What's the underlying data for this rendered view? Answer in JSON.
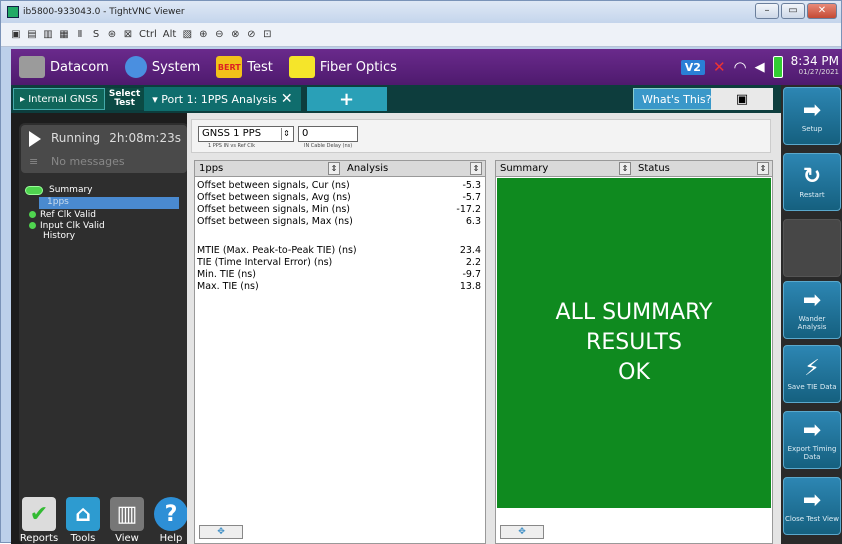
{
  "window": {
    "title": "ib5800-933043.0 - TightVNC Viewer",
    "btn_min": "–",
    "btn_max": "▭",
    "btn_close": "✕"
  },
  "vnc_toolbar": {
    "items": [
      "▣",
      "▤",
      "▥",
      "▦",
      "Ⅱ",
      "S",
      "⊛",
      "⊠",
      "Ctrl",
      "Alt",
      "▧",
      "⊕",
      "⊖",
      "⊗",
      "⊘",
      "⊡"
    ]
  },
  "topbar": {
    "items": [
      {
        "label": "Datacom",
        "icon": "datacom-icon"
      },
      {
        "label": "System",
        "icon": "gear-icon"
      },
      {
        "label": "Test",
        "icon": "test-icon",
        "icon_text": "BERT"
      },
      {
        "label": "Fiber Optics",
        "icon": "fiber-icon"
      }
    ],
    "v2": "V2",
    "time": "8:34 PM",
    "date": "01/27/2021"
  },
  "tabs": {
    "gnss": "▸ Internal GNSS",
    "select_1": "Select",
    "select_2": "Test",
    "port": "▾ Port 1: 1PPS Analysis",
    "add": "+",
    "whats_this": "What's This?",
    "camera": "▣"
  },
  "side": {
    "running": "Running",
    "runtime": "2h:08m:23s",
    "messages_icon": "≡",
    "messages": "No messages",
    "tree": {
      "summary": "Summary",
      "pps": "1pps",
      "ref": "Ref Clk Valid",
      "input": "Input Clk Valid",
      "history": "History"
    }
  },
  "bottom": [
    {
      "label": "Reports",
      "icon": "reports-icon",
      "glyph": "✔"
    },
    {
      "label": "Tools",
      "icon": "toolbox-icon",
      "glyph": "⌂"
    },
    {
      "label": "View",
      "icon": "view-icon",
      "glyph": "▥"
    },
    {
      "label": "Help",
      "icon": "help-icon",
      "glyph": "?"
    }
  ],
  "controls": {
    "select": "GNSS 1 PPS",
    "select_label": "1 PPS IN vs Ref Clk",
    "cable_value": "0",
    "cable_label": "IN Cable Delay (ns)",
    "spin": "⇕"
  },
  "left_pane": {
    "col1": "1pps",
    "col2": "Analysis",
    "foot": "✥",
    "rows": [
      {
        "label": "Offset between signals, Cur (ns)",
        "value": "-5.3"
      },
      {
        "label": "Offset between signals, Avg (ns)",
        "value": "-5.7"
      },
      {
        "label": "Offset between signals, Min (ns)",
        "value": "-17.2"
      },
      {
        "label": "Offset between signals, Max (ns)",
        "value": "6.3"
      },
      {
        "label": "MTIE (Max. Peak-to-Peak TIE) (ns)",
        "value": "23.4"
      },
      {
        "label": "TIE (Time Interval Error) (ns)",
        "value": "2.2"
      },
      {
        "label": "Min. TIE (ns)",
        "value": "-9.7"
      },
      {
        "label": "Max. TIE (ns)",
        "value": "13.8"
      }
    ]
  },
  "right_pane": {
    "col1": "Summary",
    "col2": "Status",
    "line1": "ALL SUMMARY",
    "line2": "RESULTS",
    "line3": "OK",
    "foot": "✥"
  },
  "actions": [
    {
      "label": "Setup",
      "glyph": "➡"
    },
    {
      "label": "Restart",
      "glyph": "↻"
    },
    {
      "label": "",
      "glyph": ""
    },
    {
      "label": "Wander Analysis",
      "glyph": "➡"
    },
    {
      "label": "Save TIE Data",
      "glyph": "⚡"
    },
    {
      "label": "Export Timing Data",
      "glyph": "➡"
    },
    {
      "label": "Close Test View",
      "glyph": "➡"
    }
  ],
  "colors": {
    "accent": "#4e1a6e",
    "ok_green": "#0f8a1f",
    "action_blue": "#1e7aa6"
  }
}
